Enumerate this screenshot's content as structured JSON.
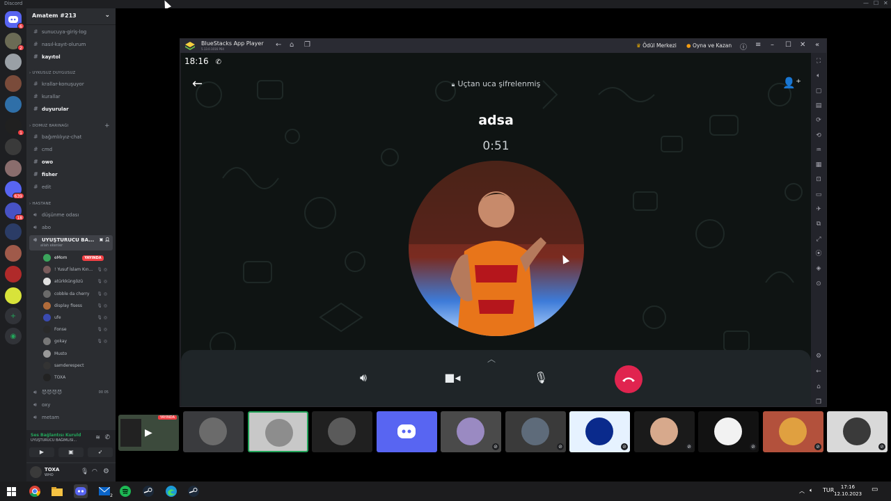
{
  "titlebar": {
    "app_name": "Discord",
    "controls": [
      "—",
      "☐",
      "✕"
    ]
  },
  "servers": [
    {
      "name": "discord-home",
      "badge": "6",
      "color": "#5865f2"
    },
    {
      "name": "server-1",
      "badge": "2",
      "color": "#6b6b55"
    },
    {
      "name": "server-2",
      "badge": "",
      "color": "#9aa0a6"
    },
    {
      "name": "server-3",
      "badge": "",
      "color": "#7a4b3a"
    },
    {
      "name": "server-4",
      "badge": "",
      "color": "#2f6fa8"
    },
    {
      "name": "server-5",
      "badge": "1",
      "color": "#202020"
    },
    {
      "name": "server-6",
      "badge": "",
      "color": "#3a3a3a"
    },
    {
      "name": "server-7",
      "badge": "",
      "color": "#8a6d6d"
    },
    {
      "name": "server-8",
      "badge": "639",
      "color": "#5865f2"
    },
    {
      "name": "server-9",
      "badge": "18",
      "color": "#4752c4"
    },
    {
      "name": "server-10",
      "badge": "",
      "color": "#2b3c66"
    },
    {
      "name": "server-11",
      "badge": "",
      "color": "#a05a4a"
    },
    {
      "name": "server-12",
      "badge": "",
      "color": "#b02a2a"
    },
    {
      "name": "server-13",
      "badge": "",
      "color": "#d8e33a"
    }
  ],
  "guild": {
    "name": "Amatem #213"
  },
  "channels": [
    {
      "type": "text",
      "name": "sunucuya-giriş-log",
      "bright": false
    },
    {
      "type": "text",
      "name": "nasıl-kayıt-olurum",
      "bright": false
    },
    {
      "type": "text",
      "name": "kayıtol",
      "bright": true
    }
  ],
  "cat1": {
    "name": "UYKUSUZ DUYGUSUZ"
  },
  "channels2": [
    {
      "type": "text",
      "name": "krallar-konuşuyor",
      "bright": false
    },
    {
      "type": "text",
      "name": "kurallar",
      "bright": false
    },
    {
      "type": "text",
      "name": "duyurular",
      "bright": true
    }
  ],
  "cat2": {
    "name": "DOMUZ BARINAĞI"
  },
  "channels3": [
    {
      "type": "text",
      "name": "bağımlılıyız-chat",
      "bright": false
    },
    {
      "type": "text",
      "name": "cmd",
      "bright": false
    },
    {
      "type": "text",
      "name": "owo",
      "bright": true
    },
    {
      "type": "text",
      "name": "fisher",
      "bright": true
    },
    {
      "type": "text",
      "name": "edit",
      "bright": false
    }
  ],
  "cat3": {
    "name": "HASTANE"
  },
  "voice": [
    {
      "name": "düşünme odası"
    },
    {
      "name": "abo"
    }
  ],
  "active_voice": {
    "name": "UYUŞTURUCU BA...",
    "sub": "allah ekenler"
  },
  "voice_users": [
    {
      "name": "eMom",
      "live": "YAYINDA",
      "color": "#3ba55c"
    },
    {
      "name": "! Yusuf İslam Kın...",
      "live": "",
      "color": "#7a5c5c"
    },
    {
      "name": "atürkküngözü",
      "live": "",
      "color": "#e0e0e0"
    },
    {
      "name": "cobble da cherry",
      "live": "",
      "color": "#6a6a6a"
    },
    {
      "name": "display fisess",
      "live": "",
      "color": "#b06b3a"
    },
    {
      "name": "ufe",
      "live": "",
      "color": "#3a4ab0"
    },
    {
      "name": "Fonse",
      "live": "",
      "color": "#2a2a2a"
    },
    {
      "name": "gokay",
      "live": "",
      "color": "#777"
    },
    {
      "name": "Musto",
      "live": "",
      "color": "#999"
    },
    {
      "name": "samderespect",
      "live": "",
      "color": "#333"
    },
    {
      "name": "TOXA",
      "live": "",
      "color": "#222"
    }
  ],
  "voice_after": [
    {
      "name": "😈😈😈😈",
      "count": "00  05"
    },
    {
      "name": "oxy"
    },
    {
      "name": "metam"
    }
  ],
  "voice_connection": {
    "status": "Ses Bağlantısı Kuruld",
    "channel": "UYUŞTURUCU BAĞIMLISI..."
  },
  "user": {
    "name": "TOXA",
    "status": "WHO"
  },
  "bluestacks": {
    "title": "BlueStacks App Player",
    "version": "5.13.0.1016 P64",
    "reward": "Ödül Merkezi",
    "play": "Oyna ve Kazan"
  },
  "call": {
    "time": "18:16",
    "encryption": "Uçtan uca şifrelenmiş",
    "contact": "adsa",
    "duration": "0:51"
  },
  "stream_tiles": [
    {
      "name": "stream-preview",
      "label": "YAYINDA",
      "bg": "#3c4a3c"
    },
    {
      "name": "user-tile-1",
      "label": "",
      "bg": "#3a3b3e"
    },
    {
      "name": "user-tile-2",
      "label": "",
      "bg": "#c8c8c8"
    },
    {
      "name": "user-tile-3",
      "label": "",
      "bg": "#202020"
    },
    {
      "name": "user-tile-4",
      "label": "",
      "bg": "#5865f2"
    },
    {
      "name": "user-tile-5",
      "label": "",
      "bg": "#4a4a4a"
    },
    {
      "name": "user-tile-6",
      "label": "",
      "bg": "#3a3a3a"
    },
    {
      "name": "user-tile-7",
      "label": "",
      "bg": "#e6f2ff"
    },
    {
      "name": "user-tile-8",
      "label": "",
      "bg": "#1a1a1a"
    },
    {
      "name": "user-tile-9",
      "label": "",
      "bg": "#121212"
    },
    {
      "name": "user-tile-10",
      "label": "",
      "bg": "#b3513c"
    },
    {
      "name": "user-tile-11",
      "label": "",
      "bg": "#d9d9d9"
    }
  ],
  "taskbar": {
    "lang": "TUR",
    "time": "17:16",
    "date": "12.10.2023",
    "mail_badge": "2"
  },
  "colors": {
    "end_call": "#e0244f",
    "live": "#f23f43",
    "online": "#23a55a"
  }
}
